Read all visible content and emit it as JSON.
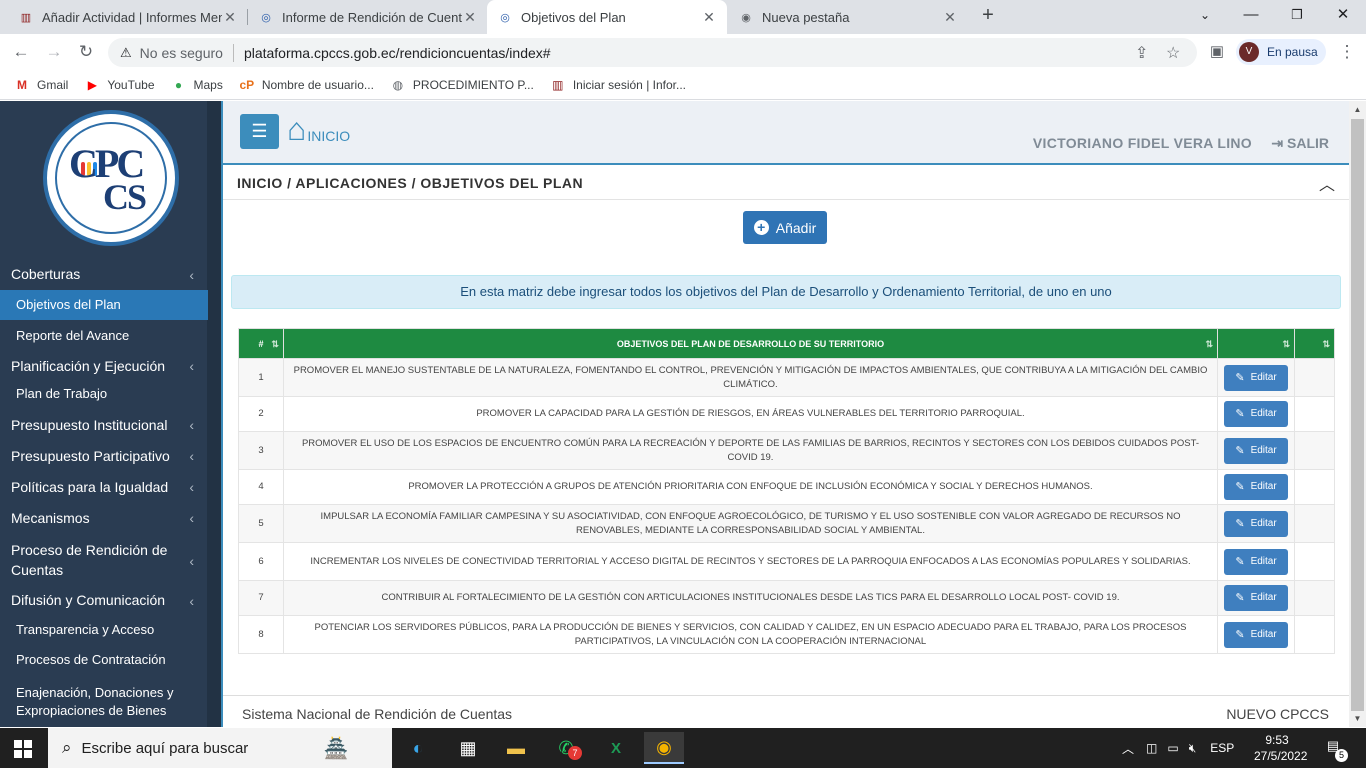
{
  "browser": {
    "tabs": [
      {
        "title": "Añadir Actividad | Informes Mens",
        "favicon": "cpccs-favicon",
        "active": false
      },
      {
        "title": "Informe de Rendición de Cuentas",
        "favicon": "cpccs-swirl-favicon",
        "active": false
      },
      {
        "title": "Objetivos del Plan",
        "favicon": "cpccs-swirl-favicon",
        "active": true
      },
      {
        "title": "Nueva pestaña",
        "favicon": "chrome-favicon",
        "active": false
      }
    ],
    "new_tab": "+",
    "security_label": "No es seguro",
    "url": "plataforma.cpccs.gob.ec/rendicioncuentas/index#",
    "profile_initial": "V",
    "profile_status": "En pausa",
    "bookmarks": [
      {
        "label": "Gmail",
        "icon": "gmail-icon"
      },
      {
        "label": "YouTube",
        "icon": "youtube-icon"
      },
      {
        "label": "Maps",
        "icon": "maps-icon"
      },
      {
        "label": "Nombre de usuario...",
        "icon": "cp-icon"
      },
      {
        "label": "PROCEDIMIENTO P...",
        "icon": "globe-icon"
      },
      {
        "label": "Iniciar sesión | Infor...",
        "icon": "cpccs-icon"
      }
    ]
  },
  "sidebar": {
    "logo_text_top": "CPC",
    "logo_text_bottom": "CS",
    "items": [
      {
        "label": "Coberturas",
        "type": "section"
      },
      {
        "label": "Objetivos del Plan",
        "type": "sub",
        "active": true
      },
      {
        "label": "Reporte del Avance",
        "type": "sub"
      },
      {
        "label": "Planificación y Ejecución",
        "type": "section"
      },
      {
        "label": "Plan de Trabajo",
        "type": "sub"
      },
      {
        "label": "Presupuesto Institucional",
        "type": "section"
      },
      {
        "label": "Presupuesto Participativo",
        "type": "section"
      },
      {
        "label": "Políticas para la Igualdad",
        "type": "section"
      },
      {
        "label": "Mecanismos",
        "type": "section"
      },
      {
        "label": "Proceso de Rendición de Cuentas",
        "type": "section"
      },
      {
        "label": "Difusión y Comunicación",
        "type": "section"
      },
      {
        "label": "Transparencia y Acceso",
        "type": "sub"
      },
      {
        "label": "Procesos de Contratación",
        "type": "sub"
      },
      {
        "label": "Enajenación, Donaciones y Expropiaciones de Bienes",
        "type": "sub"
      }
    ]
  },
  "header": {
    "home_label": "INICIO",
    "user_name": "VICTORIANO FIDEL VERA LINO",
    "logout_label": "SALIR"
  },
  "breadcrumb": "INICIO / APLICACIONES / OBJETIVOS DEL PLAN",
  "add_button": "Añadir",
  "info_message": "En esta matriz debe ingresar todos los objetivos del Plan de Desarrollo y Ordenamiento Territorial, de uno en uno",
  "table": {
    "headers": [
      "#",
      "OBJETIVOS DEL PLAN DE DESARROLLO DE SU TERRITORIO",
      "",
      ""
    ],
    "edit_label": "Editar",
    "rows": [
      {
        "n": "1",
        "objective": "PROMOVER EL MANEJO SUSTENTABLE DE LA NATURALEZA, FOMENTANDO EL CONTROL, PREVENCIÓN Y MITIGACIÓN DE IMPACTOS AMBIENTALES, QUE CONTRIBUYA A LA MITIGACIÓN DEL CAMBIO CLIMÁTICO."
      },
      {
        "n": "2",
        "objective": "PROMOVER LA CAPACIDAD PARA LA GESTIÓN DE RIESGOS, EN ÁREAS VULNERABLES DEL TERRITORIO PARROQUIAL."
      },
      {
        "n": "3",
        "objective": "PROMOVER EL USO DE LOS ESPACIOS DE ENCUENTRO COMÚN PARA LA RECREACIÓN Y DEPORTE DE LAS FAMILIAS DE BARRIOS, RECINTOS Y SECTORES CON LOS DEBIDOS CUIDADOS POST-COVID 19."
      },
      {
        "n": "4",
        "objective": "PROMOVER LA PROTECCIÓN A GRUPOS DE ATENCIÓN PRIORITARIA CON ENFOQUE DE INCLUSIÓN ECONÓMICA Y SOCIAL Y DERECHOS HUMANOS."
      },
      {
        "n": "5",
        "objective": "IMPULSAR LA ECONOMÍA FAMILIAR CAMPESINA Y SU ASOCIATIVIDAD, CON ENFOQUE AGROECOLÓGICO, DE TURISMO Y EL USO SOSTENIBLE CON VALOR AGREGADO DE RECURSOS NO RENOVABLES, MEDIANTE LA CORRESPONSABILIDAD SOCIAL Y AMBIENTAL."
      },
      {
        "n": "6",
        "objective": "INCREMENTAR LOS NIVELES DE CONECTIVIDAD TERRITORIAL Y ACCESO DIGITAL DE RECINTOS Y SECTORES DE LA PARROQUIA ENFOCADOS A LAS ECONOMÍAS POPULARES Y SOLIDARIAS."
      },
      {
        "n": "7",
        "objective": "CONTRIBUIR AL FORTALECIMIENTO DE LA GESTIÓN CON ARTICULACIONES INSTITUCIONALES DESDE LAS TICS PARA EL DESARROLLO LOCAL POST- COVID 19."
      },
      {
        "n": "8",
        "objective": "POTENCIAR LOS SERVIDORES PÚBLICOS, PARA LA PRODUCCIÓN DE BIENES Y SERVICIOS, CON CALIDAD Y CALIDEZ, EN UN ESPACIO ADECUADO PARA EL TRABAJO, PARA LOS PROCESOS PARTICIPATIVOS, LA VINCULACIÓN CON LA COOPERACIÓN INTERNACIONAL"
      }
    ]
  },
  "footer": {
    "left": "Sistema Nacional de Rendición de Cuentas",
    "right": "NUEVO CPCCS"
  },
  "taskbar": {
    "search_placeholder": "Escribe aquí para buscar",
    "whatsapp_badge": "7",
    "language": "ESP",
    "time": "9:53",
    "date": "27/5/2022",
    "notifications": "5"
  },
  "colors": {
    "sidebar_bg": "#2a3c52",
    "accent_blue": "#3c8dbc",
    "table_header_green": "#1e8a41",
    "info_bg": "#d9edf7"
  }
}
